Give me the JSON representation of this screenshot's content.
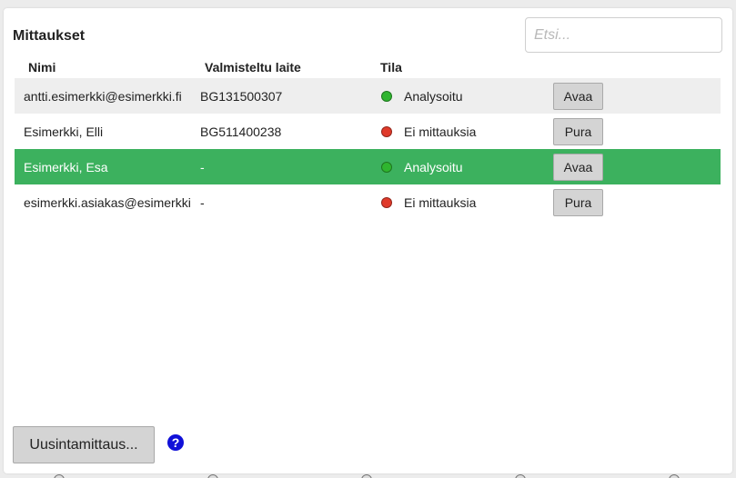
{
  "panel": {
    "title": "Mittaukset",
    "search": {
      "placeholder": "Etsi...",
      "value": ""
    }
  },
  "table": {
    "columns": {
      "name": "Nimi",
      "device": "Valmisteltu laite",
      "status": "Tila"
    },
    "rows": [
      {
        "name": "antti.esimerkki@esimerkki.fi",
        "device": "BG131500307",
        "status": "Analysoitu",
        "status_color": "#2fb52f",
        "action": "Avaa",
        "style": "stripe"
      },
      {
        "name": "Esimerkki, Elli",
        "device": "BG511400238",
        "status": "Ei mittauksia",
        "status_color": "#e03a2a",
        "action": "Pura",
        "style": "plain"
      },
      {
        "name": "Esimerkki, Esa",
        "device": "-",
        "status": "Analysoitu",
        "status_color": "#2fb52f",
        "action": "Avaa",
        "style": "selected"
      },
      {
        "name": "esimerkki.asiakas@esimerkki.fi",
        "device": "-",
        "status": "Ei mittauksia",
        "status_color": "#e03a2a",
        "action": "Pura",
        "style": "plain"
      }
    ]
  },
  "footer": {
    "remeasure_label": "Uusintamittaus...",
    "help_symbol": "?"
  },
  "colors": {
    "selected_row": "#3cb15e",
    "stripe_row": "#eeeeee",
    "help_icon": "#1010d8"
  }
}
